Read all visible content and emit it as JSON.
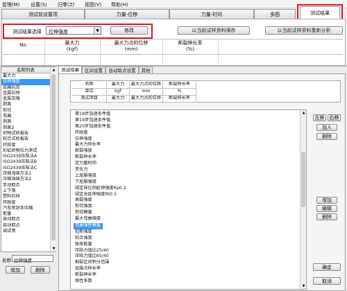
{
  "menu": [
    "管理(M)",
    "设置(S)",
    "归零(Z)",
    "视图(V)",
    "帮助(H)"
  ],
  "top_tabs": [
    "测试前设置项",
    "力量-位移",
    "力量-时间",
    "多图",
    "测试结果"
  ],
  "selector": {
    "label": "测试结果选择",
    "value": "拉伸强度",
    "modify": "修改",
    "save_current": "以当前试样资料保存",
    "recalc_current": "以当前试样资料重新分析"
  },
  "result_table": {
    "headers": [
      "No.",
      "最大力\n(kgf)",
      "最大力点的位移\n(mm)",
      "断裂伸长率\n(%)"
    ]
  },
  "left_panel": {
    "header": "名称列表",
    "items": [
      "最大力",
      "拉伸强度",
      "纸箱抗压",
      "金属拉伸",
      "金属压缩",
      "剥离",
      "剪切",
      "弯曲",
      "剥离",
      "剥离2",
      "织物试验报告",
      "粘合试验报告",
      "环刚度",
      "彩虹织物拉力测试",
      "ISO2439压陷法A",
      "ISO2439压陷法B",
      "ISO2439压陷法C",
      "压缩海绵方法1",
      "压缩海绵方法2",
      "手动取点",
      "上下限",
      "塑料拉伸",
      "环刚度",
      "汽车密封条压缩",
      "能量",
      "自动取点",
      "自动取点",
      "调试用"
    ],
    "selected_index": 1,
    "name_label": "名称",
    "name_value": "拉伸强度",
    "add": "增加",
    "delete": "删除"
  },
  "sub_tabs": [
    "测试结果",
    "区间设置",
    "自动取点设置",
    "其他"
  ],
  "def_table": {
    "col_headers": [
      "名称",
      "最大力",
      "最大力点的位移",
      "断裂伸长率"
    ],
    "rows": [
      [
        "单位",
        "kgf",
        "mm",
        "%"
      ],
      [
        "测试项目",
        "最大力",
        "最大力点的位移",
        "断裂伸长率"
      ]
    ]
  },
  "items_list": {
    "items": [
      "第18步加速条件值",
      "第19步加速条件值",
      "第20步加速条件值",
      "环刚度",
      "拉伸强度",
      "最大力伸长率",
      "断裂强度",
      "断裂伸长率",
      "定力量时间",
      "变化力",
      "上屈服强度",
      "下屈服强度",
      "规定非比例延伸强度Rp0.2",
      "规定总延伸强度Rt0.5",
      "乘裂强度",
      "剪切强度",
      "剪切模量",
      "最大弯曲强度",
      "弯曲弹性模量",
      "扯断强度",
      "粘合强度",
      "吸收能量",
      "压陷力值比25/40",
      "压陷力值比65/40",
      "割裂区间积分范围",
      "屈服点伸长率",
      "断裂伸长率",
      "弹性系数"
    ],
    "selected_index": 18
  },
  "right_buttons": {
    "left_shift": "左移",
    "right_shift": "右移",
    "add_top": "加入",
    "delete_top": "删除",
    "add": "增加",
    "edit": "编辑",
    "delete": "删除",
    "confirm": "确定",
    "cancel": "取消"
  },
  "colors": {
    "accent_red": "#e01818",
    "selected_blue": "#3399ff"
  }
}
